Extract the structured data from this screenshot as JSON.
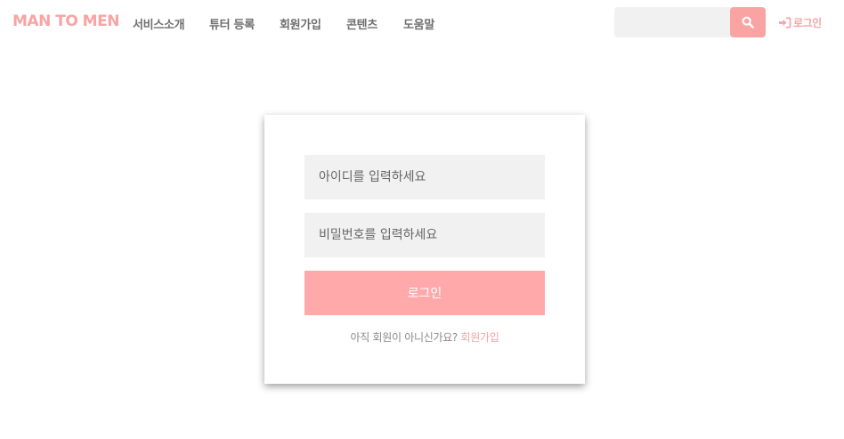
{
  "brand": {
    "logo_text": "MAN TO MEN"
  },
  "nav": {
    "items": [
      {
        "label": "서비스소개"
      },
      {
        "label": "튜터 등록"
      },
      {
        "label": "회원가입"
      },
      {
        "label": "콘텐츠"
      },
      {
        "label": "도움말"
      }
    ]
  },
  "search": {
    "placeholder": "",
    "button_icon": "search-icon"
  },
  "header_login": {
    "icon": "sign-in-icon",
    "label": "로그인"
  },
  "login_form": {
    "id_placeholder": "아이디를 입력하세요",
    "password_placeholder": "비밀번호를 입력하세요",
    "submit_label": "로그인",
    "signup_prompt": "아직 회원이 아니신가요?",
    "signup_link": "회원가입"
  },
  "colors": {
    "accent": "#f9a3a3",
    "button": "#ffa9ab",
    "input_bg": "#f1f1f1",
    "nav_text": "#6e6e6e"
  }
}
